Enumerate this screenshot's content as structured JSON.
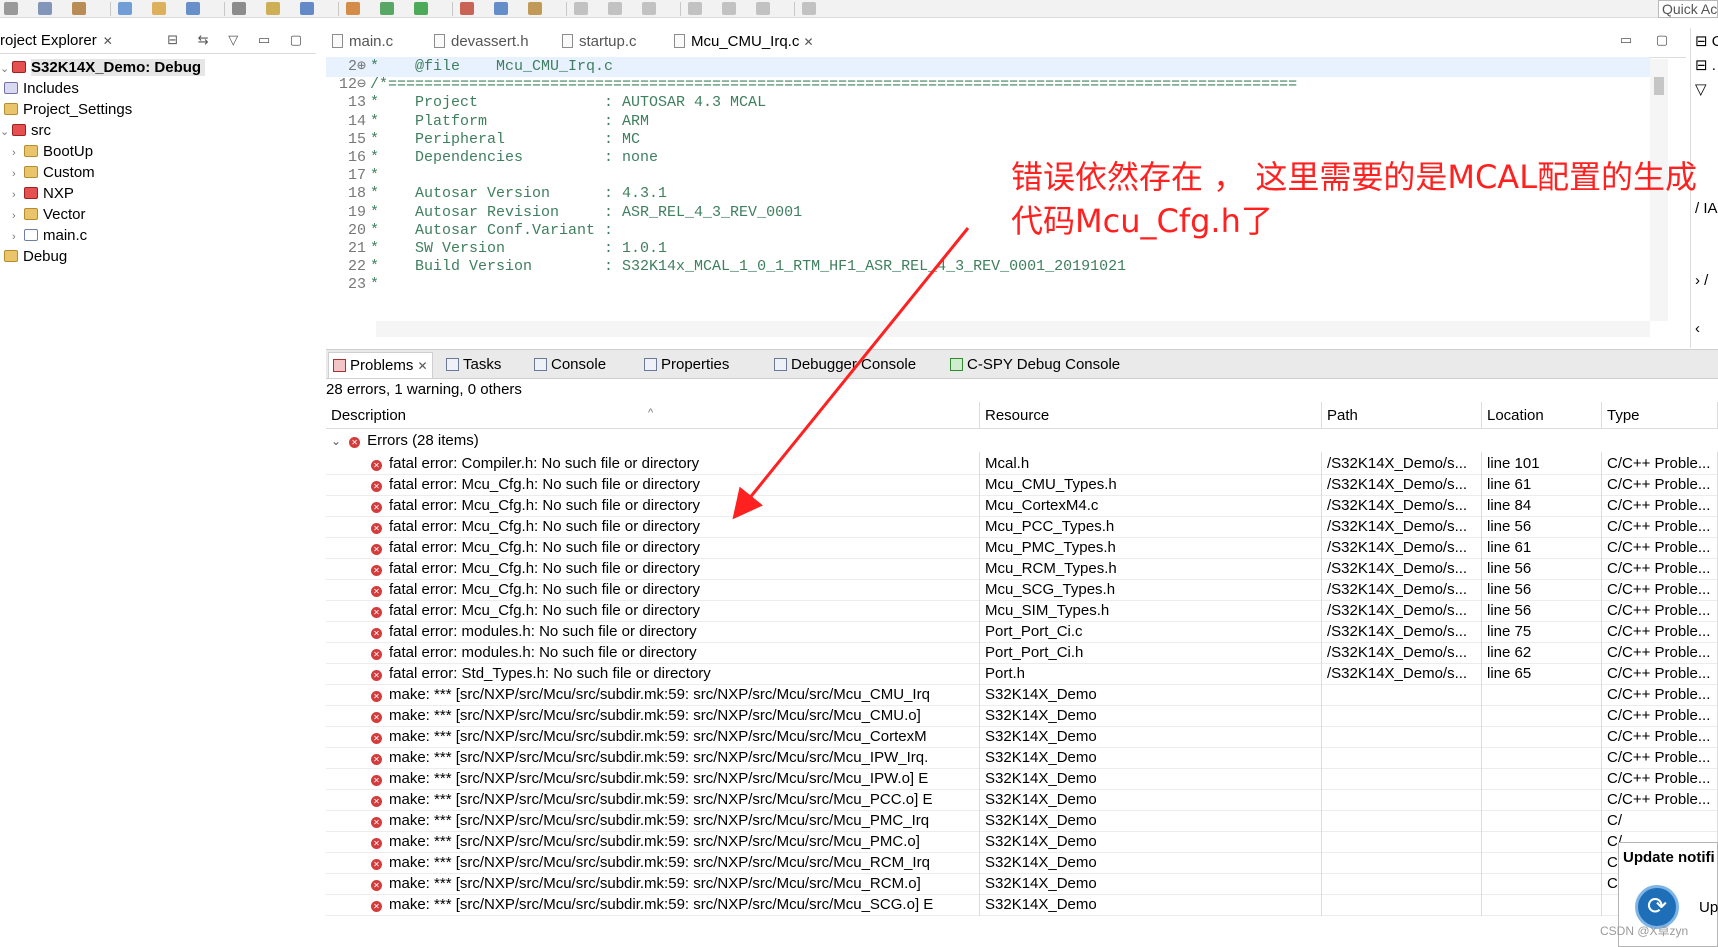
{
  "toolbar": {
    "quick_access": "Quick Access"
  },
  "project_explorer": {
    "title": "roject Explorer",
    "close": "✕",
    "tools": "⊟ ⇆ ▽ ▭ ▢",
    "items": [
      {
        "label": "S32K14X_Demo: Debug"
      },
      {
        "label": "Includes"
      },
      {
        "label": "Project_Settings"
      },
      {
        "label": "src"
      },
      {
        "label": "BootUp"
      },
      {
        "label": "Custom"
      },
      {
        "label": "NXP"
      },
      {
        "label": "Vector"
      },
      {
        "label": "main.c"
      },
      {
        "label": "Debug"
      }
    ]
  },
  "editor": {
    "tabs": [
      {
        "label": "main.c"
      },
      {
        "label": "devassert.h"
      },
      {
        "label": "startup.c"
      },
      {
        "label": "Mcu_CMU_Irq.c",
        "close": "✕"
      }
    ],
    "controls": "▭ ▢",
    "lines": [
      {
        "num": "2⊕",
        "text": "*    @file    Mcu_CMU_Irq.c"
      },
      {
        "num": "12⊖",
        "text": "/*====================================================================================================="
      },
      {
        "num": "13",
        "text": "*    Project              : AUTOSAR 4.3 MCAL"
      },
      {
        "num": "14",
        "text": "*    Platform             : ARM"
      },
      {
        "num": "15",
        "text": "*    Peripheral           : MC"
      },
      {
        "num": "16",
        "text": "*    Dependencies         : none"
      },
      {
        "num": "17",
        "text": "*"
      },
      {
        "num": "18",
        "text": "*    Autosar Version      : 4.3.1"
      },
      {
        "num": "19",
        "text": "*    Autosar Revision     : ASR_REL_4_3_REV_0001"
      },
      {
        "num": "20",
        "text": "*    Autosar Conf.Variant :"
      },
      {
        "num": "21",
        "text": "*    SW Version           : 1.0.1"
      },
      {
        "num": "22",
        "text": "*    Build Version        : S32K14x_MCAL_1_0_1_RTM_HF1_ASR_REL_4_3_REV_0001_20191021"
      },
      {
        "num": "23",
        "text": "*"
      }
    ]
  },
  "outline": {
    "lines": [
      "⊟ O",
      "⊟ .",
      "▽",
      "",
      "",
      "",
      "",
      "/ IA",
      "",
      "",
      "› /",
      "",
      "‹"
    ]
  },
  "panel": {
    "tabs": [
      {
        "label": "Problems",
        "close": "✕"
      },
      {
        "label": "Tasks"
      },
      {
        "label": "Console"
      },
      {
        "label": "Properties"
      },
      {
        "label": "Debugger Console"
      },
      {
        "label": "C-SPY Debug Console"
      }
    ],
    "summary": "28 errors, 1 warning, 0 others",
    "sort_indicator": "^",
    "columns": [
      "Description",
      "Resource",
      "Path",
      "Location",
      "Type"
    ],
    "group": {
      "toggle": "⌄",
      "label": "Errors (28 items)"
    },
    "rows": [
      {
        "desc": "fatal error: Compiler.h: No such file or directory",
        "resource": "Mcal.h",
        "path": "/S32K14X_Demo/s...",
        "location": "line 101",
        "type": "C/C++ Proble..."
      },
      {
        "desc": "fatal error: Mcu_Cfg.h: No such file or directory",
        "resource": "Mcu_CMU_Types.h",
        "path": "/S32K14X_Demo/s...",
        "location": "line 61",
        "type": "C/C++ Proble..."
      },
      {
        "desc": "fatal error: Mcu_Cfg.h: No such file or directory",
        "resource": "Mcu_CortexM4.c",
        "path": "/S32K14X_Demo/s...",
        "location": "line 84",
        "type": "C/C++ Proble..."
      },
      {
        "desc": "fatal error: Mcu_Cfg.h: No such file or directory",
        "resource": "Mcu_PCC_Types.h",
        "path": "/S32K14X_Demo/s...",
        "location": "line 56",
        "type": "C/C++ Proble..."
      },
      {
        "desc": "fatal error: Mcu_Cfg.h: No such file or directory",
        "resource": "Mcu_PMC_Types.h",
        "path": "/S32K14X_Demo/s...",
        "location": "line 61",
        "type": "C/C++ Proble..."
      },
      {
        "desc": "fatal error: Mcu_Cfg.h: No such file or directory",
        "resource": "Mcu_RCM_Types.h",
        "path": "/S32K14X_Demo/s...",
        "location": "line 56",
        "type": "C/C++ Proble..."
      },
      {
        "desc": "fatal error: Mcu_Cfg.h: No such file or directory",
        "resource": "Mcu_SCG_Types.h",
        "path": "/S32K14X_Demo/s...",
        "location": "line 56",
        "type": "C/C++ Proble..."
      },
      {
        "desc": "fatal error: Mcu_Cfg.h: No such file or directory",
        "resource": "Mcu_SIM_Types.h",
        "path": "/S32K14X_Demo/s...",
        "location": "line 56",
        "type": "C/C++ Proble..."
      },
      {
        "desc": "fatal error: modules.h: No such file or directory",
        "resource": "Port_Port_Ci.c",
        "path": "/S32K14X_Demo/s...",
        "location": "line 75",
        "type": "C/C++ Proble..."
      },
      {
        "desc": "fatal error: modules.h: No such file or directory",
        "resource": "Port_Port_Ci.h",
        "path": "/S32K14X_Demo/s...",
        "location": "line 62",
        "type": "C/C++ Proble..."
      },
      {
        "desc": "fatal error: Std_Types.h: No such file or directory",
        "resource": "Port.h",
        "path": "/S32K14X_Demo/s...",
        "location": "line 65",
        "type": "C/C++ Proble..."
      },
      {
        "desc": "make: *** [src/NXP/src/Mcu/src/subdir.mk:59: src/NXP/src/Mcu/src/Mcu_CMU_Irq",
        "resource": "S32K14X_Demo",
        "path": "",
        "location": "",
        "type": "C/C++ Proble..."
      },
      {
        "desc": "make: *** [src/NXP/src/Mcu/src/subdir.mk:59: src/NXP/src/Mcu/src/Mcu_CMU.o]",
        "resource": "S32K14X_Demo",
        "path": "",
        "location": "",
        "type": "C/C++ Proble..."
      },
      {
        "desc": "make: *** [src/NXP/src/Mcu/src/subdir.mk:59: src/NXP/src/Mcu/src/Mcu_CortexM",
        "resource": "S32K14X_Demo",
        "path": "",
        "location": "",
        "type": "C/C++ Proble..."
      },
      {
        "desc": "make: *** [src/NXP/src/Mcu/src/subdir.mk:59: src/NXP/src/Mcu/src/Mcu_IPW_Irq.",
        "resource": "S32K14X_Demo",
        "path": "",
        "location": "",
        "type": "C/C++ Proble..."
      },
      {
        "desc": "make: *** [src/NXP/src/Mcu/src/subdir.mk:59: src/NXP/src/Mcu/src/Mcu_IPW.o] E",
        "resource": "S32K14X_Demo",
        "path": "",
        "location": "",
        "type": "C/C++ Proble..."
      },
      {
        "desc": "make: *** [src/NXP/src/Mcu/src/subdir.mk:59: src/NXP/src/Mcu/src/Mcu_PCC.o] E",
        "resource": "S32K14X_Demo",
        "path": "",
        "location": "",
        "type": "C/C++ Proble..."
      },
      {
        "desc": "make: *** [src/NXP/src/Mcu/src/subdir.mk:59: src/NXP/src/Mcu/src/Mcu_PMC_Irq",
        "resource": "S32K14X_Demo",
        "path": "",
        "location": "",
        "type": "C/"
      },
      {
        "desc": "make: *** [src/NXP/src/Mcu/src/subdir.mk:59: src/NXP/src/Mcu/src/Mcu_PMC.o]",
        "resource": "S32K14X_Demo",
        "path": "",
        "location": "",
        "type": "C/"
      },
      {
        "desc": "make: *** [src/NXP/src/Mcu/src/subdir.mk:59: src/NXP/src/Mcu/src/Mcu_RCM_Irq",
        "resource": "S32K14X_Demo",
        "path": "",
        "location": "",
        "type": "C/"
      },
      {
        "desc": "make: *** [src/NXP/src/Mcu/src/subdir.mk:59: src/NXP/src/Mcu/src/Mcu_RCM.o]",
        "resource": "S32K14X_Demo",
        "path": "",
        "location": "",
        "type": "C/"
      },
      {
        "desc": "make: *** [src/NXP/src/Mcu/src/subdir.mk:59: src/NXP/src/Mcu/src/Mcu_SCG.o] E",
        "resource": "S32K14X_Demo",
        "path": "",
        "location": "",
        "type": ""
      }
    ]
  },
  "annotation": {
    "line1": "错误依然存在 ， 这里需要的是MCAL配置的生成",
    "line2": "代码Mcu_Cfg.h了",
    "color": "#ff2020"
  },
  "update_notification": {
    "title": "Update notifi",
    "icon": "⟳",
    "text": "Up"
  },
  "watermark": "CSDN @X卓zyn"
}
